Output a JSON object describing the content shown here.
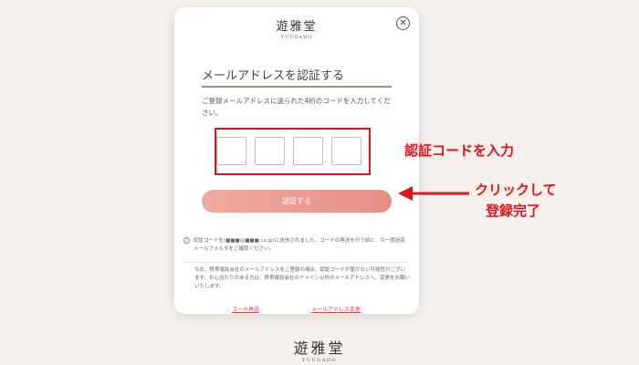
{
  "modal": {
    "logo": {
      "kanji": "遊雅堂",
      "roman": "YUUGADO"
    },
    "close_icon": "close-icon",
    "title": "メールアドレスを認証する",
    "description": "ご登録メールアドレスに送られた4桁のコードを入力してください。",
    "code_fields": [
      "",
      "",
      "",
      ""
    ],
    "submit_label": "認証する",
    "info_text": "認証コードを(■■■@■■■.co.jp)に送信されました。コードの再送を行う前に、今一度迷惑メールフォルダをご確認ください。",
    "note_text": "なお、携帯電話会社のメールアドレスをご登録の場合、認証コードが届かない可能性がございます。お心当たりのある方は、携帯電話会社のドメイン以外のメールアドレスへ、変更をお願いいたします。",
    "links": {
      "resend": "コード再送",
      "change_email": "メールアドレス変更"
    }
  },
  "annotations": {
    "code_label": "認証コードを入力",
    "click_label": "クリックして",
    "done_label": "登録完了",
    "color": "#e0141e"
  },
  "footer_logo": {
    "kanji": "遊雅堂",
    "roman": "YUUGADO"
  }
}
